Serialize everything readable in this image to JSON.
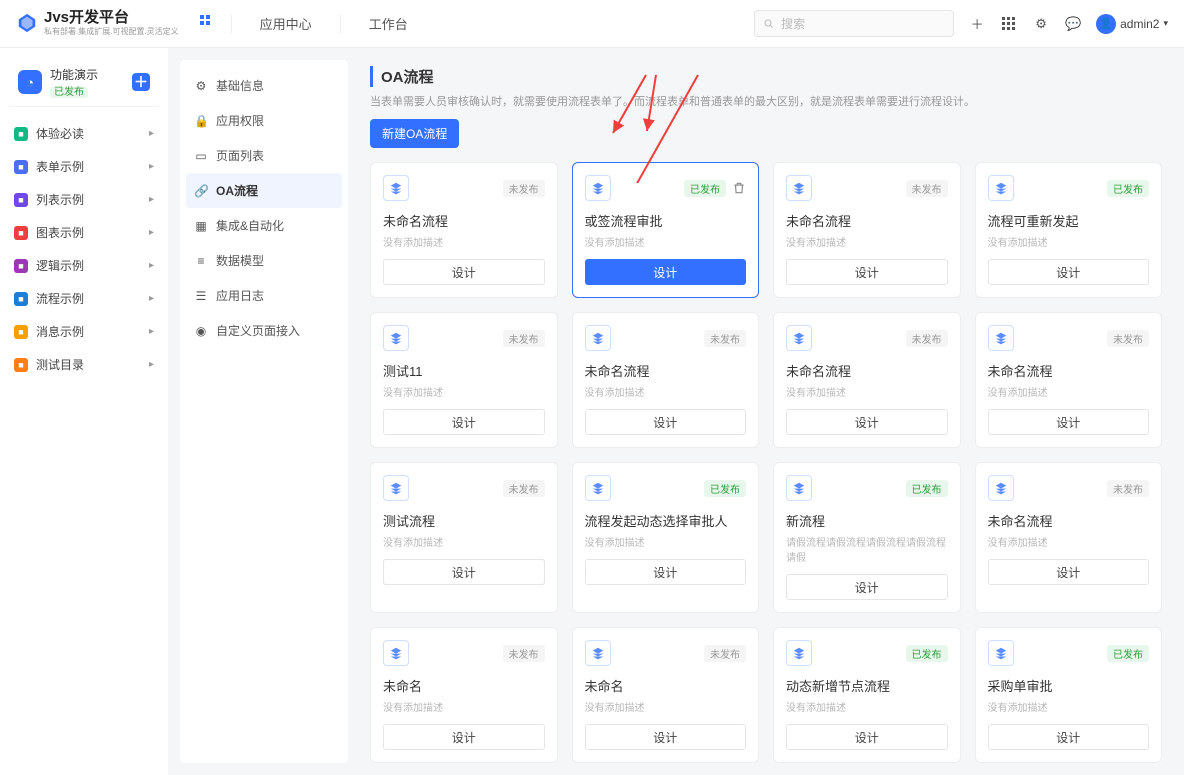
{
  "header": {
    "logoTitle": "Jvs开发平台",
    "logoSub": "私有部署.集成扩展.可视配置.灵活定义",
    "nav": [
      "应用中心",
      "工作台"
    ],
    "searchPlaceholder": "搜索",
    "user": "admin2"
  },
  "leftTop": {
    "title": "功能演示",
    "tag": "已发布"
  },
  "leftItems": [
    {
      "label": "体验必读",
      "color": "#12b886"
    },
    {
      "label": "表单示例",
      "color": "#4c6ef5"
    },
    {
      "label": "列表示例",
      "color": "#7048e8"
    },
    {
      "label": "图表示例",
      "color": "#f03e3e"
    },
    {
      "label": "逻辑示例",
      "color": "#9c36b5"
    },
    {
      "label": "流程示例",
      "color": "#1c7ed6"
    },
    {
      "label": "消息示例",
      "color": "#f59f00"
    },
    {
      "label": "测试目录",
      "color": "#fd7e14"
    }
  ],
  "midItems": [
    {
      "icon": "gear",
      "label": "基础信息"
    },
    {
      "icon": "lock",
      "label": "应用权限"
    },
    {
      "icon": "page",
      "label": "页面列表"
    },
    {
      "icon": "link",
      "label": "OA流程",
      "active": true
    },
    {
      "icon": "grid",
      "label": "集成&自动化"
    },
    {
      "icon": "db",
      "label": "数据模型"
    },
    {
      "icon": "log",
      "label": "应用日志"
    },
    {
      "icon": "dot",
      "label": "自定义页面接入"
    }
  ],
  "page": {
    "title": "OA流程",
    "desc": "当表单需要人员审核确认时，就需要使用流程表单了。而流程表单和普通表单的最大区别，就是流程表单需要进行流程设计。",
    "newBtn": "新建OA流程",
    "designLabel": "设计",
    "noDesc": "没有添加描述"
  },
  "cards": [
    {
      "title": "未命名流程",
      "desc": null,
      "status": "unpublished"
    },
    {
      "title": "或签流程审批",
      "desc": null,
      "status": "published",
      "selected": true,
      "showDelete": true
    },
    {
      "title": "未命名流程",
      "desc": null,
      "status": "unpublished"
    },
    {
      "title": "流程可重新发起",
      "desc": null,
      "status": "published"
    },
    {
      "title": "测试11",
      "desc": null,
      "status": "unpublished"
    },
    {
      "title": "未命名流程",
      "desc": null,
      "status": "unpublished"
    },
    {
      "title": "未命名流程",
      "desc": null,
      "status": "unpublished"
    },
    {
      "title": "未命名流程",
      "desc": null,
      "status": "unpublished"
    },
    {
      "title": "测试流程",
      "desc": null,
      "status": "unpublished"
    },
    {
      "title": "流程发起动态选择审批人",
      "desc": null,
      "status": "published"
    },
    {
      "title": "新流程",
      "desc": "请假流程请假流程请假流程请假流程请假",
      "status": "published"
    },
    {
      "title": "未命名流程",
      "desc": null,
      "status": "unpublished"
    },
    {
      "title": "未命名",
      "desc": null,
      "status": "unpublished"
    },
    {
      "title": "未命名",
      "desc": null,
      "status": "unpublished"
    },
    {
      "title": "动态新增节点流程",
      "desc": null,
      "status": "published"
    },
    {
      "title": "采购单审批",
      "desc": null,
      "status": "published"
    }
  ],
  "statusLabels": {
    "unpublished": "未发布",
    "published": "已发布"
  }
}
